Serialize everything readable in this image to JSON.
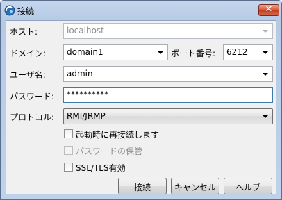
{
  "window": {
    "title": "接続",
    "close_symbol": "✕"
  },
  "form": {
    "host_label": "ホスト:",
    "host_value": "localhost",
    "domain_label": "ドメイン:",
    "domain_value": "domain1",
    "port_label": "ポート番号:",
    "port_value": "6212",
    "user_label": "ユーザ名:",
    "user_value": "admin",
    "password_label": "パスワード:",
    "password_value": "**********",
    "protocol_label": "プロトコル:",
    "protocol_value": "RMI/JRMP"
  },
  "options": {
    "reconnect_label": "起動時に再接続します",
    "save_password_label": "パスワードの保管",
    "ssl_label": "SSL/TLS有効"
  },
  "buttons": {
    "connect": "接続",
    "cancel": "キャンセル",
    "help": "ヘルプ"
  },
  "colors": {
    "title_bar": "#c5d6ec",
    "close_button": "#d6553a",
    "dialog_body": "#f0f0f0"
  }
}
